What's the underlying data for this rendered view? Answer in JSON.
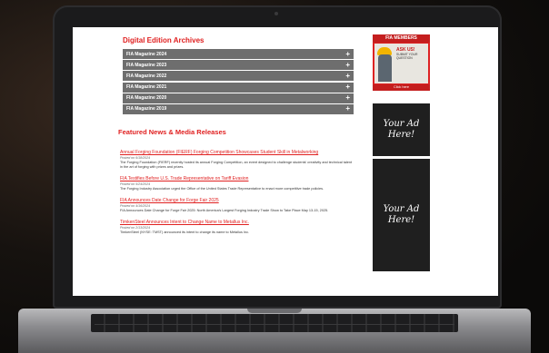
{
  "archives": {
    "title": "Digital Edition Archives",
    "items": [
      {
        "label": "FIA Magazine 2024"
      },
      {
        "label": "FIA Magazine 2023"
      },
      {
        "label": "FIA Magazine 2022"
      },
      {
        "label": "FIA Magazine 2021"
      },
      {
        "label": "FIA Magazine 2020"
      },
      {
        "label": "FIA Magazine 2019"
      }
    ],
    "expand_symbol": "+"
  },
  "news": {
    "title": "Featured News & Media Releases",
    "items": [
      {
        "headline": "Annual Forging Foundation (FIERF) Forging Competition Showcases Student Skill in Metalworking",
        "date": "Posted on 6/18/2024",
        "summary": "The Forging Foundation (FIERF) recently hosted its annual Forging Competition, an event designed to challenge students' creativity and technical talent in the art of forging with prizes and prizes."
      },
      {
        "headline": "FIA Testifies Before U.S. Trade Representative on Tariff Evasion",
        "date": "Posted on 5/24/2024",
        "summary": "The Forging Industry Association urged the Office of the United States Trade Representative to enact more competitive trade policies."
      },
      {
        "headline": "FIA Announces Date Change for Forge Fair 2025",
        "date": "Posted on 4/16/2024",
        "summary": "FIA Announces Date Change for Forge Fair 2025: North America's Largest Forging Industry Trade Show to Take Place May 13-15, 2025."
      },
      {
        "headline": "TimkenSteel Announces Intent to Change Name to Metallus Inc.",
        "date": "Posted on 2/13/2024",
        "summary": "TimkenSteel (NYSE: TMST) announced its intent to change its name to Metallus Inc."
      }
    ]
  },
  "sidebar": {
    "members": {
      "header": "FIA MEMBERS",
      "ask": "ASK US!",
      "sub": "SUBMIT YOUR QUESTION",
      "footer": "Click here"
    },
    "ads": [
      {
        "text": "Your Ad Here!"
      },
      {
        "text": "Your Ad Here!"
      }
    ]
  },
  "colors": {
    "accent": "#e02020",
    "accordion": "#6e6e6e",
    "ad_bg": "#1f1f1f"
  }
}
